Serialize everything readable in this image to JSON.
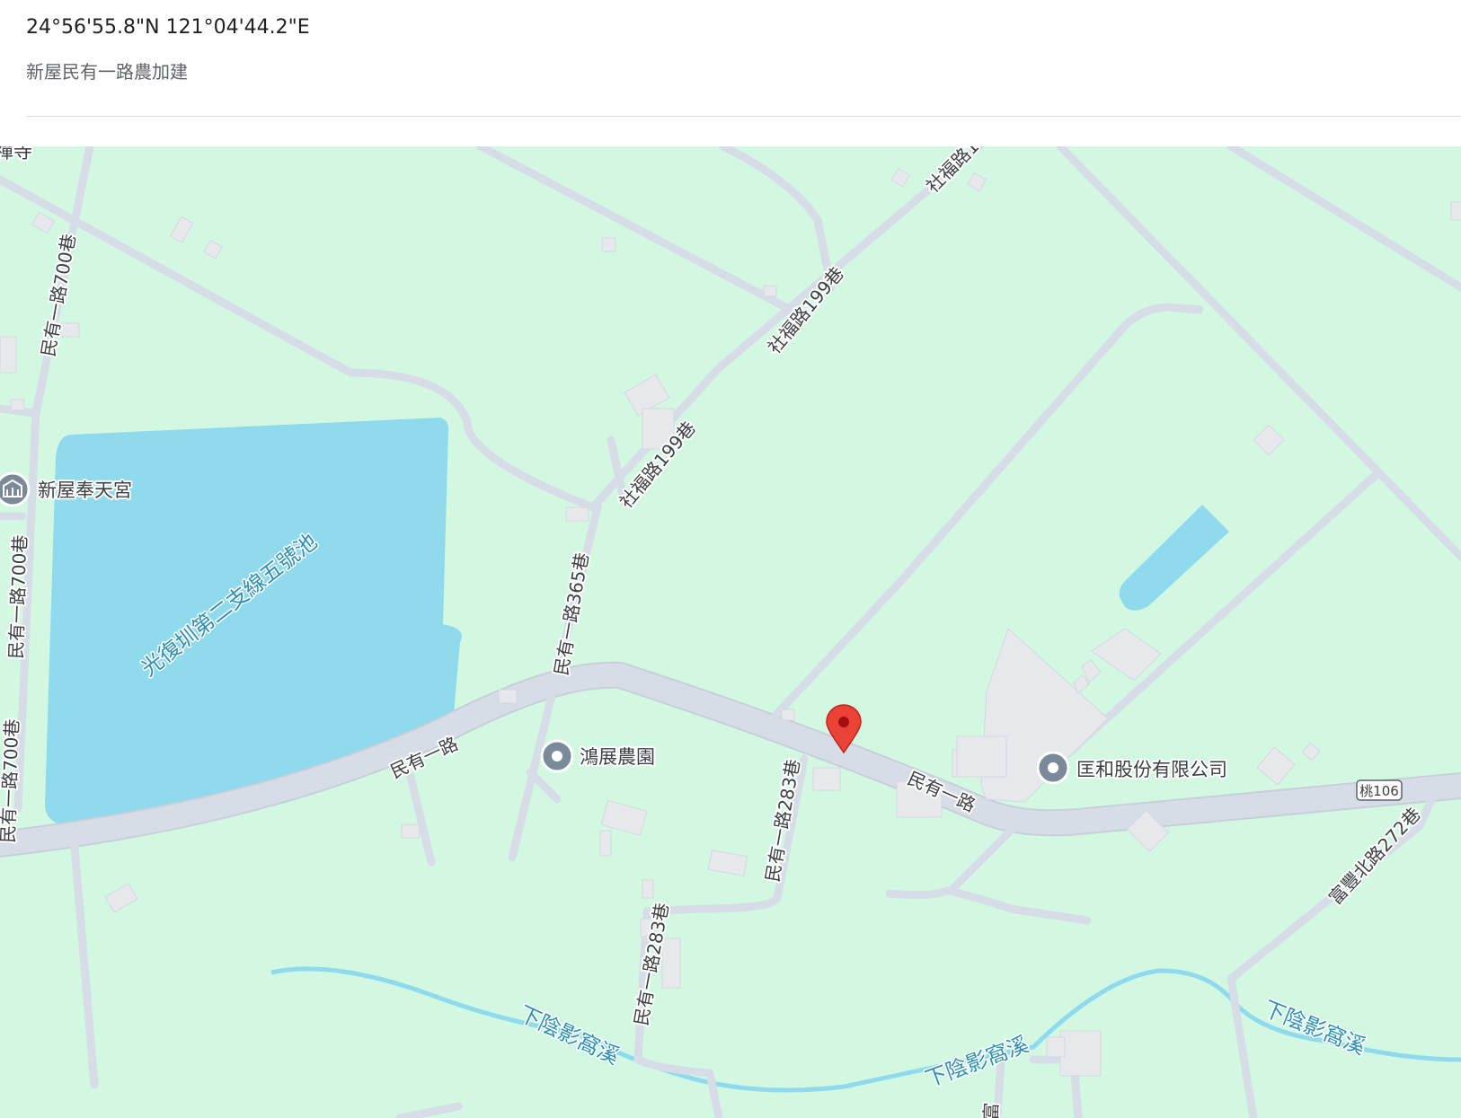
{
  "header": {
    "coordinates": "24°56'55.8\"N 121°04'44.2\"E",
    "place_name": "新屋民有一路農加建"
  },
  "map": {
    "colors": {
      "land": "#d3f8e2",
      "water": "#90daee",
      "road": "#d6dde6",
      "road_edge": "#c4ccd6",
      "building": "#e6e8ec",
      "pin": "#ea4335",
      "poi": "#7b8a99"
    },
    "roads": {
      "minyou_1": "民有一路",
      "minyou_2": "民有一路",
      "lane_365": "民有一路365巷",
      "lane_283_a": "民有一路283巷",
      "lane_283_b": "民有一路283巷",
      "lane_700_a": "民有一路700巷",
      "lane_700_b": "民有一路700巷",
      "lane_700_c": "民有一路700巷",
      "shefu_199_a": "社福路199巷",
      "shefu_199_b": "社福路199巷",
      "shefu_top": "社福路1",
      "fufeng_272": "富豐北路272巷",
      "route_badge": "桃106",
      "bottom_partial": "富"
    },
    "water": {
      "pond": "光復圳第二支線五號池",
      "stream_1": "下陰影窩溪",
      "stream_2": "下陰影窩溪",
      "stream_3": "下陰影窩溪"
    },
    "pois": {
      "temple_partial": "禪寺",
      "temple": "新屋奉天宮",
      "farm": "鴻展農園",
      "company": "匡和股份有限公司"
    },
    "icons": {
      "pin": "map-pin-icon",
      "temple": "temple-icon",
      "poi": "place-marker-icon"
    }
  }
}
